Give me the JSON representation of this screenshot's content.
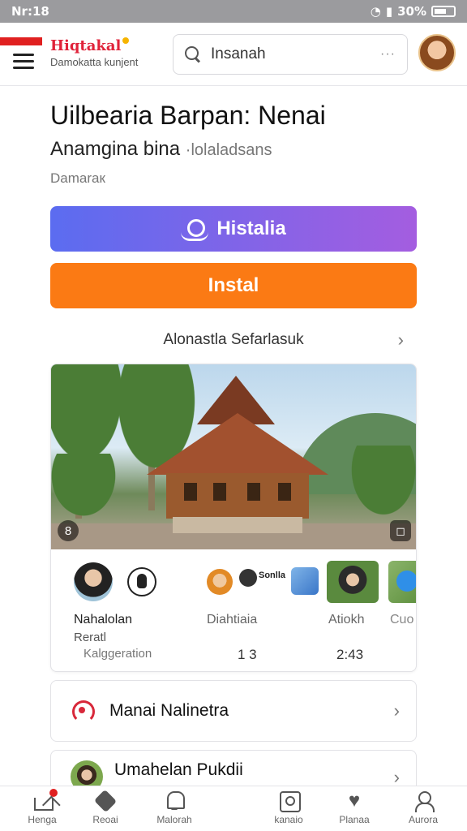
{
  "status_bar": {
    "time": "Nr:18",
    "battery": "30%"
  },
  "header": {
    "brand_name": "Hiqtakal",
    "brand_tagline": "Damokatta kunjent",
    "search_placeholder": "Insanah",
    "search_more": "···"
  },
  "page": {
    "title": "Uilbearia Barpan: Nenai",
    "subtitle": "Anamgina bina",
    "subtitle_muted": "·lolaladsans",
    "meta": "Damaraк",
    "primary_button": "Histalia",
    "install_button": "Instal",
    "detail_link": "Alonastla Sefarlasuk"
  },
  "card": {
    "photo_badge": "8",
    "stats": {
      "label_1": "Nahalolan",
      "label_2": "Diahtiaia",
      "label_3": "Atiokh",
      "label_4": "Cuo",
      "sub_1": "Reratl",
      "value_1": "Kalggeration",
      "value_2": "1 3",
      "value_3": "2:43"
    },
    "tag_text": "Sonlla"
  },
  "rows": [
    {
      "label": "Manai Nalinetra"
    },
    {
      "label": "Umahelan Pukdii"
    }
  ],
  "bottom_nav": [
    {
      "label": "Henga"
    },
    {
      "label": "Reoai"
    },
    {
      "label": "Malorah"
    },
    {
      "label": "kanaio"
    },
    {
      "label": "Planaa"
    },
    {
      "label": "Aurora"
    }
  ],
  "colors": {
    "brand_red": "#e0233a",
    "primary_gradient_start": "#5b6cf0",
    "primary_gradient_end": "#a45de0",
    "install_orange": "#fb7a14"
  }
}
